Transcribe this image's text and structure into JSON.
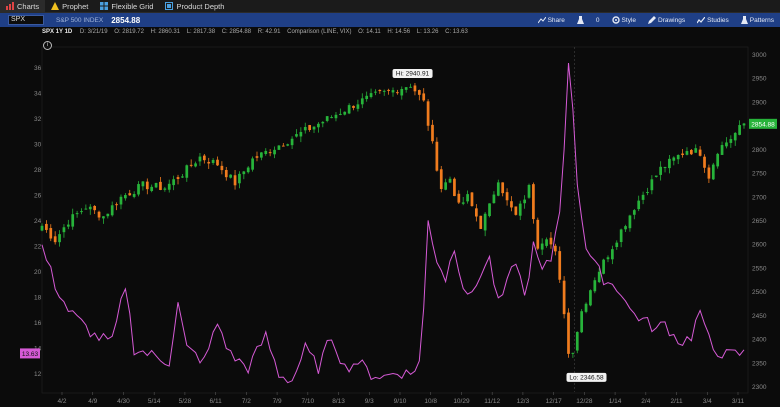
{
  "tabs": [
    {
      "label": "Charts",
      "icon": "charts-icon",
      "active": true
    },
    {
      "label": "Prophet",
      "icon": "warning-icon",
      "active": false
    },
    {
      "label": "Flexible Grid",
      "icon": "grid-icon",
      "active": false
    },
    {
      "label": "Product Depth",
      "icon": "depth-icon",
      "active": false
    }
  ],
  "toolbar": {
    "symbol": "SPX",
    "symbol_description": "S&P 500 INDEX",
    "last_price": "2854.88",
    "share_label": "Share",
    "alert_count": "0",
    "style_label": "Style",
    "drawings_label": "Drawings",
    "studies_label": "Studies",
    "patterns_label": "Patterns"
  },
  "chart_header": {
    "symbol_period": "SPX 1Y 1D",
    "date": "D: 3/21/19",
    "open": "O: 2819.72",
    "high": "H: 2860.31",
    "low": "L: 2817.38",
    "close": "C: 2854.88",
    "change": "R: 42.91",
    "comparison": "Comparison (LINE, VIX)",
    "cmp_open": "O: 14.11",
    "cmp_high": "H: 14.56",
    "cmp_low": "L: 13.26",
    "cmp_close": "C: 13.63"
  },
  "chart_data": {
    "type": "candlestick",
    "series": [
      {
        "name": "SPX",
        "right_axis_ticks": [
          3000,
          2950,
          2900,
          2850,
          2800,
          2750,
          2700,
          2650,
          2600,
          2550,
          2500,
          2450,
          2400,
          2350,
          2300
        ],
        "range": [
          2300,
          3000
        ]
      },
      {
        "name": "VIX",
        "left_axis_ticks": [
          36,
          34,
          32,
          30,
          28,
          26,
          24,
          22,
          20,
          18,
          16,
          14,
          12
        ],
        "range": [
          11,
          37
        ]
      }
    ],
    "x_tick_labels": [
      "4/2",
      "4/9",
      "4/30",
      "5/14",
      "5/28",
      "6/11",
      "7/2",
      "7/9",
      "7/10",
      "8/13",
      "9/3",
      "9/10",
      "10/8",
      "10/29",
      "11/12",
      "12/3",
      "12/17",
      "12/28",
      "1/14",
      "2/4",
      "2/11",
      "3/4",
      "3/11"
    ],
    "hi_label": "Hi: 2940.91",
    "lo_label": "Lo: 2346.58",
    "spx_current": "2854.88",
    "vix_current": "13.63",
    "spx_anchors": [
      [
        0,
        2640
      ],
      [
        3,
        2610
      ],
      [
        6,
        2650
      ],
      [
        10,
        2680
      ],
      [
        14,
        2660
      ],
      [
        18,
        2700
      ],
      [
        23,
        2725
      ],
      [
        28,
        2720
      ],
      [
        32,
        2750
      ],
      [
        36,
        2785
      ],
      [
        40,
        2770
      ],
      [
        44,
        2730
      ],
      [
        48,
        2780
      ],
      [
        52,
        2800
      ],
      [
        56,
        2820
      ],
      [
        60,
        2840
      ],
      [
        64,
        2860
      ],
      [
        68,
        2880
      ],
      [
        72,
        2900
      ],
      [
        76,
        2915
      ],
      [
        80,
        2925
      ],
      [
        84,
        2938
      ],
      [
        87,
        2900
      ],
      [
        89,
        2810
      ],
      [
        91,
        2720
      ],
      [
        93,
        2740
      ],
      [
        95,
        2680
      ],
      [
        97,
        2700
      ],
      [
        100,
        2640
      ],
      [
        102,
        2680
      ],
      [
        104,
        2740
      ],
      [
        106,
        2690
      ],
      [
        108,
        2660
      ],
      [
        111,
        2720
      ],
      [
        113,
        2600
      ],
      [
        115,
        2620
      ],
      [
        117,
        2580
      ],
      [
        119,
        2460
      ],
      [
        120,
        2370
      ],
      [
        121,
        2380
      ],
      [
        123,
        2460
      ],
      [
        126,
        2530
      ],
      [
        129,
        2580
      ],
      [
        132,
        2630
      ],
      [
        135,
        2680
      ],
      [
        138,
        2720
      ],
      [
        141,
        2760
      ],
      [
        144,
        2780
      ],
      [
        147,
        2800
      ],
      [
        150,
        2795
      ],
      [
        152,
        2745
      ],
      [
        154,
        2800
      ],
      [
        157,
        2825
      ],
      [
        160,
        2855
      ]
    ],
    "vix_anchors": [
      [
        0,
        22
      ],
      [
        3,
        19
      ],
      [
        6,
        17
      ],
      [
        9,
        16
      ],
      [
        12,
        15
      ],
      [
        16,
        14.5
      ],
      [
        19,
        19
      ],
      [
        21,
        14
      ],
      [
        25,
        13.5
      ],
      [
        29,
        13
      ],
      [
        31,
        17.5
      ],
      [
        33,
        14
      ],
      [
        37,
        13
      ],
      [
        40,
        16
      ],
      [
        43,
        13.5
      ],
      [
        47,
        12.5
      ],
      [
        51,
        15
      ],
      [
        54,
        12
      ],
      [
        57,
        11.5
      ],
      [
        60,
        14
      ],
      [
        63,
        12.5
      ],
      [
        66,
        15
      ],
      [
        69,
        12.5
      ],
      [
        72,
        13
      ],
      [
        75,
        12
      ],
      [
        78,
        11.8
      ],
      [
        81,
        12.2
      ],
      [
        84,
        12
      ],
      [
        86,
        13
      ],
      [
        87,
        17
      ],
      [
        88,
        24
      ],
      [
        90,
        21
      ],
      [
        92,
        19.5
      ],
      [
        94,
        22
      ],
      [
        96,
        19
      ],
      [
        98,
        18
      ],
      [
        100,
        20
      ],
      [
        102,
        21
      ],
      [
        104,
        17.5
      ],
      [
        106,
        19
      ],
      [
        108,
        21
      ],
      [
        110,
        18
      ],
      [
        112,
        22
      ],
      [
        114,
        20
      ],
      [
        116,
        21
      ],
      [
        118,
        25
      ],
      [
        119,
        30
      ],
      [
        120,
        36
      ],
      [
        121,
        33
      ],
      [
        122,
        27
      ],
      [
        124,
        22
      ],
      [
        126,
        20.5
      ],
      [
        128,
        19.5
      ],
      [
        130,
        19
      ],
      [
        132,
        18.5
      ],
      [
        134,
        17
      ],
      [
        136,
        16.5
      ],
      [
        138,
        16
      ],
      [
        140,
        15.5
      ],
      [
        142,
        16
      ],
      [
        144,
        15
      ],
      [
        146,
        14.5
      ],
      [
        148,
        15
      ],
      [
        150,
        17
      ],
      [
        151,
        15.5
      ],
      [
        153,
        14
      ],
      [
        156,
        13.5
      ],
      [
        160,
        13.63
      ]
    ]
  }
}
